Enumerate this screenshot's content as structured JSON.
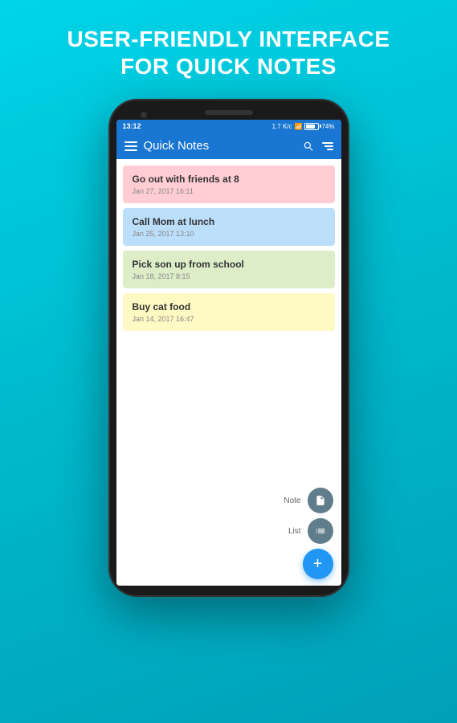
{
  "headline": {
    "line1": "USER-FRIENDLY INTERFACE",
    "line2": "FOR QUICK NOTES"
  },
  "status_bar": {
    "time": "13:12",
    "network": "1.7 K/c",
    "battery_percent": "74%"
  },
  "app_bar": {
    "title": "Quick Notes",
    "search_label": "search",
    "sort_label": "sort"
  },
  "notes": [
    {
      "id": 1,
      "color": "pink",
      "title": "Go out with friends at 8",
      "date": "Jan 27, 2017 16:11"
    },
    {
      "id": 2,
      "color": "blue",
      "title": "Call Mom at lunch",
      "date": "Jan 25, 2017 13:10"
    },
    {
      "id": 3,
      "color": "green",
      "title": "Pick son up from school",
      "date": "Jan 18, 2017 8:15"
    },
    {
      "id": 4,
      "color": "yellow",
      "title": "Buy cat food",
      "date": "Jan 14, 2017 16:47"
    }
  ],
  "fab": {
    "note_label": "Note",
    "list_label": "List",
    "add_label": "+"
  }
}
